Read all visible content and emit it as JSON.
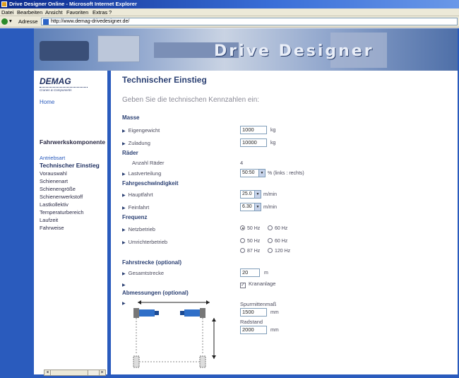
{
  "window": {
    "title": "Drive Designer Online - Microsoft Internet Explorer"
  },
  "menu": [
    "Datei",
    "Bearbeiten",
    "Ansicht",
    "Favoriten",
    "Extras",
    "?"
  ],
  "address": {
    "label": "Adresse",
    "url": "http://www.demag-drivedesigner.de/"
  },
  "banner": {
    "brand": "Drive Designer"
  },
  "logo": {
    "name": "DEMAG",
    "tagline": "Cranes & Components"
  },
  "sidebar": {
    "home": "Home",
    "section": "Fahrwerkskomponente",
    "items": [
      {
        "label": "Antriebsart",
        "state": "link"
      },
      {
        "label": "Technischer Einstieg",
        "state": "active"
      },
      {
        "label": "Vorauswahl",
        "state": "normal"
      },
      {
        "label": "Schienenart",
        "state": "normal"
      },
      {
        "label": "Schienengröße",
        "state": "normal"
      },
      {
        "label": "Schienenwerkstoff",
        "state": "normal"
      },
      {
        "label": "Lastkollektiv",
        "state": "normal"
      },
      {
        "label": "Temperaturbereich",
        "state": "normal"
      },
      {
        "label": "Laufzeit",
        "state": "normal"
      },
      {
        "label": "Fahrweise",
        "state": "normal"
      }
    ]
  },
  "main": {
    "heading": "Technischer Einstieg",
    "intro": "Geben Sie die technischen Kennzahlen ein:",
    "masse": {
      "title": "Masse",
      "eigengewicht": {
        "label": "Eigengewicht",
        "value": "1000",
        "unit": "kg"
      },
      "zuladung": {
        "label": "Zuladung",
        "value": "10000",
        "unit": "kg"
      }
    },
    "raeder": {
      "title": "Räder",
      "anzahl": {
        "label": "Anzahl Räder",
        "value": "4"
      },
      "lastverteilung": {
        "label": "Lastverteilung",
        "value": "50:50",
        "unit": "% (links : rechts)"
      }
    },
    "geschwindigkeit": {
      "title": "Fahrgeschwindigkeit",
      "hauptfahrt": {
        "label": "Hauptfahrt",
        "value": "25.0",
        "unit": "m/min"
      },
      "feinfahrt": {
        "label": "Feinfahrt",
        "value": "6.30",
        "unit": "m/min"
      }
    },
    "frequenz": {
      "title": "Frequenz",
      "netzbetrieb": {
        "label": "Netzbetrieb",
        "options": [
          "50 Hz",
          "60 Hz"
        ],
        "selected": "50 Hz"
      },
      "umrichterbetrieb": {
        "label": "Umrichterbetrieb",
        "options": [
          "50 Hz",
          "60 Hz",
          "87 Hz",
          "120 Hz"
        ],
        "selected": ""
      }
    },
    "fahrstrecke": {
      "title": "Fahrstrecke (optional)",
      "gesamtstrecke": {
        "label": "Gesamtstrecke",
        "value": "20",
        "unit": "m"
      },
      "krananlage": {
        "label": "Krananlage",
        "checked": true
      }
    },
    "abmessungen": {
      "title": "Abmessungen (optional)",
      "spurmitte": {
        "label": "Spurmittenmaß",
        "value": "1500",
        "unit": "mm"
      },
      "radstand": {
        "label": "Radstand",
        "value": "2000",
        "unit": "mm"
      }
    }
  },
  "colors": {
    "page_blue": "#2a5bbd",
    "heading": "#2a3f72",
    "wheel_blue": "#2f6fc8"
  }
}
